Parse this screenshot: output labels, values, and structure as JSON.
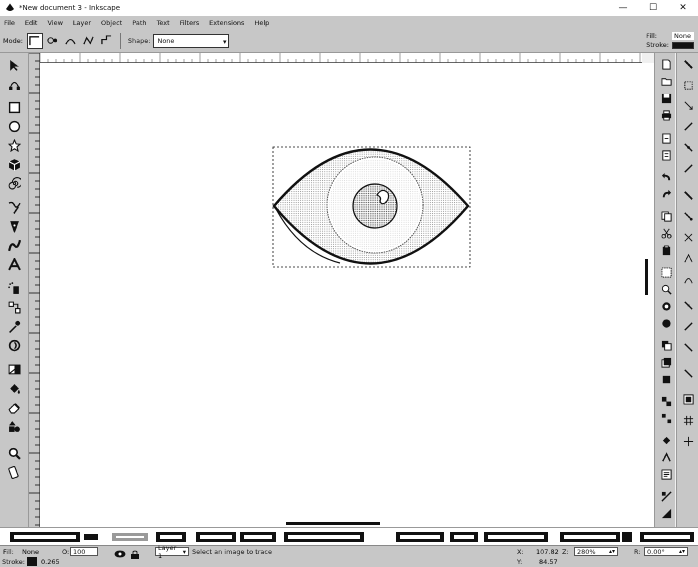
{
  "window": {
    "title": "*New document 3 - Inkscape",
    "controls": [
      "—",
      "☐",
      "✕"
    ]
  },
  "menu": [
    "File",
    "Edit",
    "View",
    "Layer",
    "Object",
    "Path",
    "Text",
    "Filters",
    "Extensions",
    "Help"
  ],
  "tool_controls": {
    "mode_label": "Mode:",
    "shape_label": "Shape:",
    "shape_value": "None",
    "fill_label": "Fill:",
    "fill_value": "None",
    "stroke_label": "Stroke:"
  },
  "canvas": {
    "selection": "eye drawing"
  },
  "statusbar": {
    "fill_label": "Fill:",
    "fill_value": "None",
    "stroke_label": "Stroke:",
    "stroke_width": "0.265",
    "opacity": "100",
    "layer": "Layer 1",
    "message": "Select an image to trace",
    "x_label": "X:",
    "x_value": "107.82",
    "y_label": "Y:",
    "y_value": "84.57",
    "zoom_label": "Z:",
    "zoom_value": "280%",
    "rotation_label": "R:",
    "rotation_value": "0.00°"
  },
  "colors": {
    "accent": "#111111",
    "canvas": "#ffffff",
    "chrome": "#e6e6e6"
  }
}
